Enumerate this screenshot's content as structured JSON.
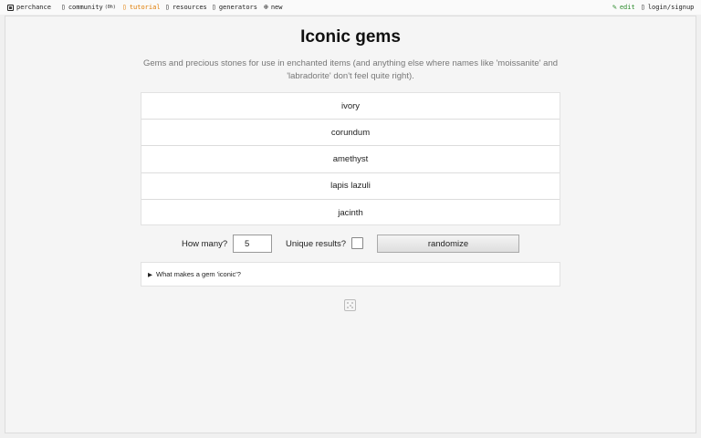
{
  "nav": {
    "brand": "perchance",
    "community": "community",
    "community_count": "(0h)",
    "tutorial": "tutorial",
    "resources": "resources",
    "generators": "generators",
    "new": "new",
    "edit": "edit",
    "login": "login/signup"
  },
  "page": {
    "title": "Iconic gems",
    "description": "Gems and precious stones for use in enchanted items (and anything else where names like 'moissanite' and 'labradorite' don't feel quite right)."
  },
  "results": [
    "ivory",
    "corundum",
    "amethyst",
    "lapis lazuli",
    "jacinth"
  ],
  "controls": {
    "how_many_label": "How many?",
    "how_many_value": "5",
    "unique_label": "Unique results?",
    "unique_checked": false,
    "randomize_label": "randomize"
  },
  "details": {
    "summary": "What makes a gem 'iconic'?"
  },
  "colors": {
    "tutorial": "#e07b00",
    "edit": "#2a8a2a"
  }
}
